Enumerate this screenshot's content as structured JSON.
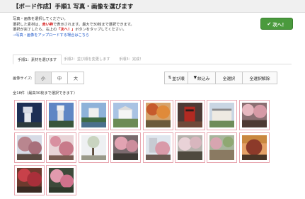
{
  "header": {
    "title": "【ボード作成】手順1  写真・画像を選びます"
  },
  "instructions": {
    "line1": "写真・画像を選択してください。",
    "line2_a": "選択した素材は、",
    "line2_red": "赤い枠",
    "line2_b": "で表示されます。最大で30枚まで選択できます。",
    "line3_a": "選択が完了したら、右上の",
    "line3_red": "「次へ！」",
    "line3_b": "ボタンをタップしてください。",
    "link": "→写真・画像をアップロードする場合はこちら"
  },
  "next_button": {
    "label": "次へ！"
  },
  "tabs": [
    {
      "label": "手順1：素材を選びます"
    },
    {
      "label": "手順2：並び順を変更します"
    },
    {
      "label": "手順3：完成！"
    }
  ],
  "size": {
    "label": "画像サイズ:",
    "options": [
      "小",
      "中",
      "大"
    ],
    "selected": "小"
  },
  "toolbar": {
    "sort": "並び順",
    "filter": "絞込み",
    "select_all": "全選択",
    "deselect_all": "全選択解除"
  },
  "count_text": "全18件（最高30枚まで選択できます）",
  "thumbnails": [
    {
      "icon": "castle-night-photo"
    },
    {
      "icon": "castle-tower-photo"
    },
    {
      "icon": "castle-moat-photo"
    },
    {
      "icon": "castle-white-photo"
    },
    {
      "icon": "autumn-leaves-photo"
    },
    {
      "icon": "red-temple-photo"
    },
    {
      "icon": "western-building-photo"
    },
    {
      "icon": "cherry-blossom-photo"
    },
    {
      "icon": "cherry-tree-photo"
    },
    {
      "icon": "blossom-branches-photo"
    },
    {
      "icon": "park-path-photo"
    },
    {
      "icon": "cherry-park-photo"
    },
    {
      "icon": "blossom-building-photo"
    },
    {
      "icon": "blossom-grove-photo"
    },
    {
      "icon": "garden-path-photo"
    },
    {
      "icon": "sunset-tree-photo"
    },
    {
      "icon": "red-blossom-photo"
    },
    {
      "icon": "pink-blossom-photo"
    }
  ]
}
